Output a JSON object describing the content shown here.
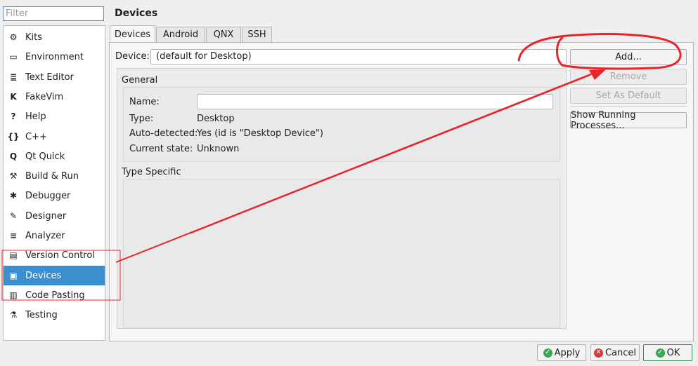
{
  "filter": {
    "placeholder": "Filter"
  },
  "sidebar": {
    "items": [
      {
        "label": "Kits",
        "icon": "kits-icon",
        "glyph": "⚙"
      },
      {
        "label": "Environment",
        "icon": "monitor-icon",
        "glyph": "▭"
      },
      {
        "label": "Text Editor",
        "icon": "text-editor-icon",
        "glyph": "≣"
      },
      {
        "label": "FakeVim",
        "icon": "fakevim-icon",
        "glyph": "K"
      },
      {
        "label": "Help",
        "icon": "help-icon",
        "glyph": "?"
      },
      {
        "label": "C++",
        "icon": "cpp-icon",
        "glyph": "{}"
      },
      {
        "label": "Qt Quick",
        "icon": "qt-quick-icon",
        "glyph": "Q"
      },
      {
        "label": "Build & Run",
        "icon": "hammer-icon",
        "glyph": "⚒"
      },
      {
        "label": "Debugger",
        "icon": "bug-icon",
        "glyph": "✱"
      },
      {
        "label": "Designer",
        "icon": "pen-icon",
        "glyph": "✎"
      },
      {
        "label": "Analyzer",
        "icon": "analyzer-icon",
        "glyph": "≡"
      },
      {
        "label": "Version Control",
        "icon": "version-control-icon",
        "glyph": "▤"
      },
      {
        "label": "Devices",
        "icon": "devices-icon",
        "glyph": "▣"
      },
      {
        "label": "Code Pasting",
        "icon": "clipboard-icon",
        "glyph": "▥"
      },
      {
        "label": "Testing",
        "icon": "flask-icon",
        "glyph": "⚗"
      }
    ],
    "selected": "Devices"
  },
  "page": {
    "title": "Devices"
  },
  "tabs": [
    {
      "label": "Devices",
      "active": true
    },
    {
      "label": "Android",
      "active": false
    },
    {
      "label": "QNX",
      "active": false
    },
    {
      "label": "SSH",
      "active": false
    }
  ],
  "device": {
    "label": "Device:",
    "value": "(default for Desktop)"
  },
  "general": {
    "title": "General",
    "name_label": "Name:",
    "name_value": "",
    "type_label": "Type:",
    "type_value": "Desktop",
    "autodetected_label": "Auto-detected:",
    "autodetected_value": "Yes (id is \"Desktop Device\")",
    "state_label": "Current state:",
    "state_value": "Unknown"
  },
  "type_specific": {
    "title": "Type Specific"
  },
  "actions": {
    "add": "Add...",
    "remove": "Remove",
    "set_default": "Set As Default",
    "show_running": "Show Running Processes..."
  },
  "dialog": {
    "apply": "Apply",
    "cancel": "Cancel",
    "ok": "OK"
  },
  "colors": {
    "selection": "#3c8fce",
    "annotation": "#e8242a"
  }
}
